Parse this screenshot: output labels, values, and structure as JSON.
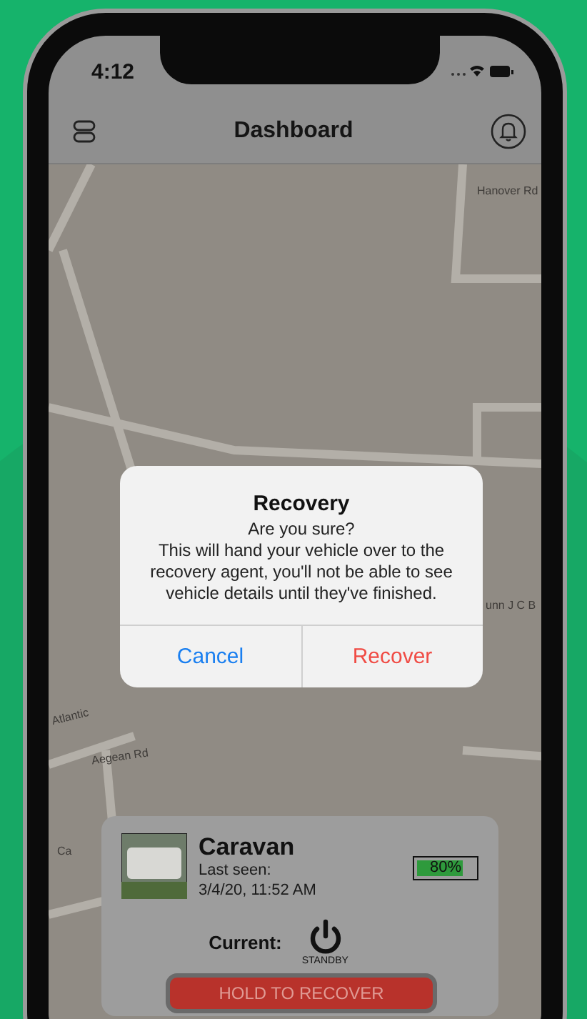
{
  "status_bar": {
    "time": "4:12"
  },
  "nav": {
    "title": "Dashboard"
  },
  "map": {
    "labels": [
      "Hanover Rd",
      "unn J C B",
      "Atlantic",
      "Aegean Rd",
      "Ca"
    ]
  },
  "dialog": {
    "title": "Recovery",
    "message": "Are you sure?\nThis will hand your vehicle over to the recovery agent, you'll not be able to see vehicle details until they've finished.",
    "buttons": [
      {
        "label": "Cancel",
        "kind": "cancel"
      },
      {
        "label": "Recover",
        "kind": "destructive"
      }
    ]
  },
  "vehicle": {
    "name": "Caravan",
    "last_seen_label": "Last seen:",
    "last_seen": "3/4/20, 11:52 AM",
    "battery": {
      "level": 0.8,
      "reading": "80%"
    },
    "current_label": "Current:",
    "mode": "STANDBY"
  },
  "action_button": "HOLD TO RECOVER"
}
